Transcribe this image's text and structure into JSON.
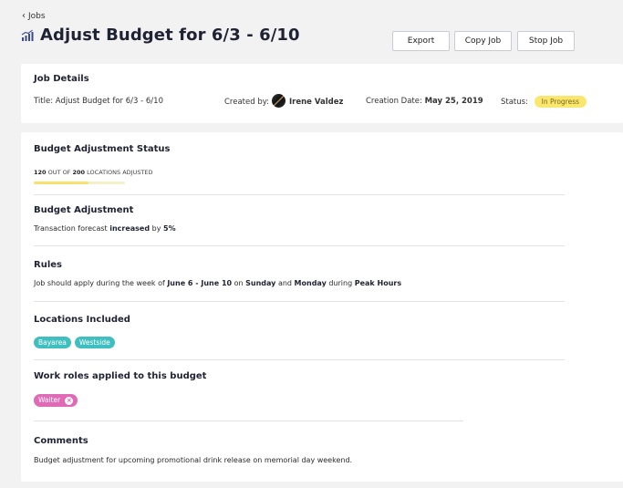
{
  "breadcrumb": {
    "back_label": "Jobs"
  },
  "header": {
    "title": "Adjust Budget for 6/3 - 6/10"
  },
  "toolbar": {
    "export_label": "Export",
    "copy_label": "Copy Job",
    "stop_label": "Stop Job"
  },
  "job_details": {
    "heading": "Job Details",
    "title_label": "Title:",
    "title_value": "Adjust Budget for 6/3 - 6/10",
    "created_by_label": "Created by:",
    "created_by_value": "Irene Valdez",
    "creation_date_label": "Creation Date:",
    "creation_date_value": "May 25, 2019",
    "status_label": "Status:",
    "status_value": "In Progress",
    "status_color": "#fbe76d"
  },
  "budget_status": {
    "heading": "Budget Adjustment Status",
    "adjusted": "120",
    "out_of_label": "OUT OF",
    "total": "200",
    "suffix": "LOCATIONS ADJUSTED",
    "progress_fraction": 0.6
  },
  "budget_adjustment": {
    "heading": "Budget Adjustment",
    "text_prefix": "Transaction forecast",
    "direction": "increased",
    "by_label": "by",
    "amount": "5%"
  },
  "rules": {
    "heading": "Rules",
    "text_1": "Job should apply during the week of",
    "week": "June 6 - June 10",
    "on_label": "on",
    "day_1": "Sunday",
    "and_label": "and",
    "day_2": "Monday",
    "during_label": "during",
    "hours": "Peak Hours"
  },
  "locations": {
    "heading": "Locations Included",
    "tags": [
      "Bayarea",
      "Westside"
    ],
    "tag_color": "#3fbfbf"
  },
  "work_roles": {
    "heading": "Work roles applied to this budget",
    "tags": [
      "Waiter"
    ],
    "tag_color": "#e06ab5"
  },
  "comments": {
    "heading": "Comments",
    "text": "Budget adjustment for upcoming promotional drink release on memorial day weekend."
  },
  "icons": {
    "back": "chevron-left-icon",
    "title": "chart-icon",
    "remove": "close-icon"
  }
}
